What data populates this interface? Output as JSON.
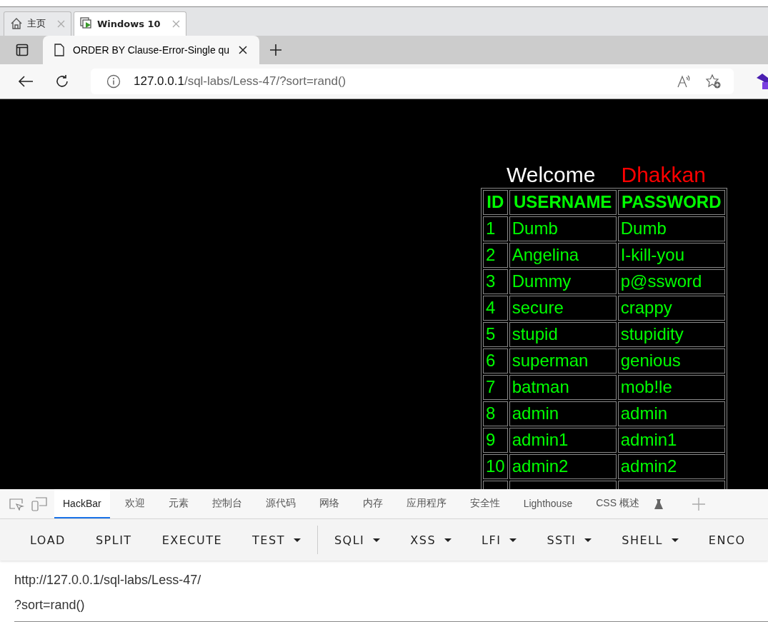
{
  "window_tabs": [
    {
      "label": "主页",
      "selected": false
    },
    {
      "label": "Windows 10",
      "selected": true
    }
  ],
  "browser_tab": {
    "title": "ORDER BY Clause-Error-Single qu"
  },
  "address_bar": {
    "host": "127.0.0.1",
    "path": "/sql-labs/Less-47/?sort=rand()"
  },
  "page": {
    "welcome": "Welcome",
    "name": "Dhakkan",
    "table": {
      "columns": [
        "ID",
        "USERNAME",
        "PASSWORD"
      ],
      "rows": [
        [
          "1",
          "Dumb",
          "Dumb"
        ],
        [
          "2",
          "Angelina",
          "I-kill-you"
        ],
        [
          "3",
          "Dummy",
          "p@ssword"
        ],
        [
          "4",
          "secure",
          "crappy"
        ],
        [
          "5",
          "stupid",
          "stupidity"
        ],
        [
          "6",
          "superman",
          "genious"
        ],
        [
          "7",
          "batman",
          "mob!le"
        ],
        [
          "8",
          "admin",
          "admin"
        ],
        [
          "9",
          "admin1",
          "admin1"
        ],
        [
          "10",
          "admin2",
          "admin2"
        ]
      ]
    }
  },
  "devtools_tabs": [
    {
      "label": "HackBar",
      "selected": true
    },
    {
      "label": "欢迎",
      "selected": false
    },
    {
      "label": "元素",
      "selected": false
    },
    {
      "label": "控制台",
      "selected": false
    },
    {
      "label": "源代码",
      "selected": false
    },
    {
      "label": "网络",
      "selected": false
    },
    {
      "label": "内存",
      "selected": false
    },
    {
      "label": "应用程序",
      "selected": false
    },
    {
      "label": "安全性",
      "selected": false
    },
    {
      "label": "Lighthouse",
      "selected": false
    },
    {
      "label": "CSS 概述",
      "selected": false
    }
  ],
  "hackbar_buttons": [
    {
      "label": "LOAD",
      "dropdown": false
    },
    {
      "label": "SPLIT",
      "dropdown": false
    },
    {
      "label": "EXECUTE",
      "dropdown": false
    },
    {
      "label": "TEST",
      "dropdown": true
    },
    {
      "label": "SQLI",
      "dropdown": true
    },
    {
      "label": "XSS",
      "dropdown": true
    },
    {
      "label": "LFI",
      "dropdown": true
    },
    {
      "label": "SSTI",
      "dropdown": true
    },
    {
      "label": "SHELL",
      "dropdown": true
    },
    {
      "label": "ENCO",
      "dropdown": false
    }
  ],
  "url_field": {
    "lines": [
      "http://127.0.0.1/sql-labs/Less-47/",
      "?sort=rand()"
    ]
  }
}
